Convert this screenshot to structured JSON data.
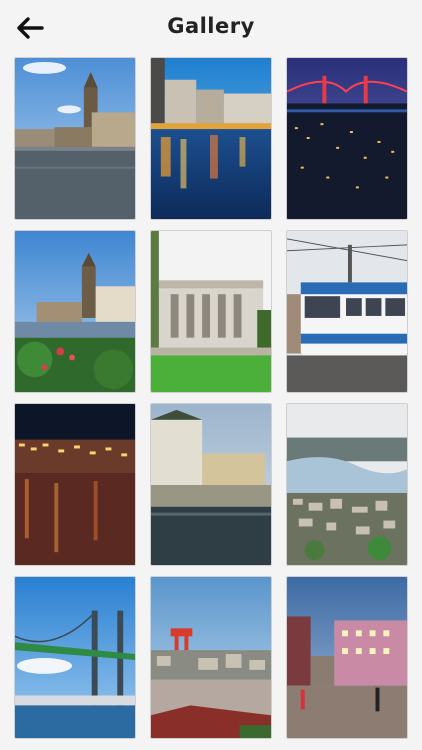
{
  "header": {
    "title": "Gallery",
    "back_icon": "arrow-left-icon"
  },
  "gallery": {
    "photos": [
      {
        "name": "photo-canal-church-tower"
      },
      {
        "name": "photo-canal-night-lights"
      },
      {
        "name": "photo-bridge-night-skyline"
      },
      {
        "name": "photo-church-riverside-garden"
      },
      {
        "name": "photo-museum-building-lawn"
      },
      {
        "name": "photo-blue-white-tram"
      },
      {
        "name": "photo-night-harbour-reflections"
      },
      {
        "name": "photo-waterfront-warehouses"
      },
      {
        "name": "photo-aerial-harbour-city"
      },
      {
        "name": "photo-suspension-bridge-green"
      },
      {
        "name": "photo-red-crane-industrial"
      },
      {
        "name": "photo-evening-street-square"
      }
    ]
  }
}
